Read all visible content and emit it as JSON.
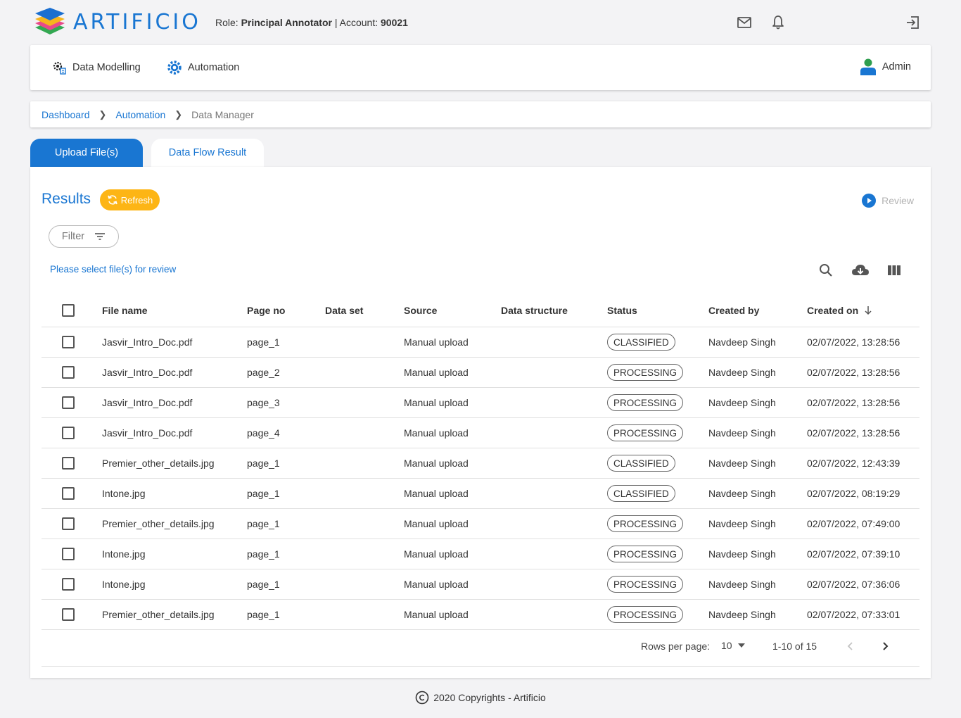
{
  "header": {
    "brand": "ARTIFICIO",
    "role_label": "Role:",
    "role_value": "Principal Annotator",
    "separator": "|",
    "account_label": "Account:",
    "account_value": "90021"
  },
  "nav": {
    "items": [
      {
        "label": "Data Modelling",
        "icon": "data-modelling-icon"
      },
      {
        "label": "Automation",
        "icon": "gear-icon"
      }
    ],
    "user": "Admin"
  },
  "breadcrumb": [
    "Dashboard",
    "Automation",
    "Data Manager"
  ],
  "tabs": [
    "Upload File(s)",
    "Data Flow Result"
  ],
  "results": {
    "title": "Results",
    "refresh": "Refresh",
    "review": "Review",
    "filter": "Filter",
    "hint": "Please select file(s) for review"
  },
  "table": {
    "columns": [
      "File name",
      "Page no",
      "Data set",
      "Source",
      "Data structure",
      "Status",
      "Created by",
      "Created on"
    ],
    "rows": [
      {
        "file": "Jasvir_Intro_Doc.pdf",
        "page": "page_1",
        "dataset": "",
        "source": "Manual upload",
        "structure": "",
        "status": "CLASSIFIED",
        "by": "Navdeep Singh",
        "on": "02/07/2022, 13:28:56"
      },
      {
        "file": "Jasvir_Intro_Doc.pdf",
        "page": "page_2",
        "dataset": "",
        "source": "Manual upload",
        "structure": "",
        "status": "PROCESSING",
        "by": "Navdeep Singh",
        "on": "02/07/2022, 13:28:56"
      },
      {
        "file": "Jasvir_Intro_Doc.pdf",
        "page": "page_3",
        "dataset": "",
        "source": "Manual upload",
        "structure": "",
        "status": "PROCESSING",
        "by": "Navdeep Singh",
        "on": "02/07/2022, 13:28:56"
      },
      {
        "file": "Jasvir_Intro_Doc.pdf",
        "page": "page_4",
        "dataset": "",
        "source": "Manual upload",
        "structure": "",
        "status": "PROCESSING",
        "by": "Navdeep Singh",
        "on": "02/07/2022, 13:28:56"
      },
      {
        "file": "Premier_other_details.jpg",
        "page": "page_1",
        "dataset": "",
        "source": "Manual upload",
        "structure": "",
        "status": "CLASSIFIED",
        "by": "Navdeep Singh",
        "on": "02/07/2022, 12:43:39"
      },
      {
        "file": "Intone.jpg",
        "page": "page_1",
        "dataset": "",
        "source": "Manual upload",
        "structure": "",
        "status": "CLASSIFIED",
        "by": "Navdeep Singh",
        "on": "02/07/2022, 08:19:29"
      },
      {
        "file": "Premier_other_details.jpg",
        "page": "page_1",
        "dataset": "",
        "source": "Manual upload",
        "structure": "",
        "status": "PROCESSING",
        "by": "Navdeep Singh",
        "on": "02/07/2022, 07:49:00"
      },
      {
        "file": "Intone.jpg",
        "page": "page_1",
        "dataset": "",
        "source": "Manual upload",
        "structure": "",
        "status": "PROCESSING",
        "by": "Navdeep Singh",
        "on": "02/07/2022, 07:39:10"
      },
      {
        "file": "Intone.jpg",
        "page": "page_1",
        "dataset": "",
        "source": "Manual upload",
        "structure": "",
        "status": "PROCESSING",
        "by": "Navdeep Singh",
        "on": "02/07/2022, 07:36:06"
      },
      {
        "file": "Premier_other_details.jpg",
        "page": "page_1",
        "dataset": "",
        "source": "Manual upload",
        "structure": "",
        "status": "PROCESSING",
        "by": "Navdeep Singh",
        "on": "02/07/2022, 07:33:01"
      }
    ]
  },
  "pagination": {
    "rows_per_page_label": "Rows per page:",
    "rows_per_page": "10",
    "range": "1-10 of 15"
  },
  "footer": {
    "copyright": "2020 Copyrights - Artificio"
  },
  "colors": {
    "primary": "#1976d2",
    "refresh": "#fdb515"
  }
}
